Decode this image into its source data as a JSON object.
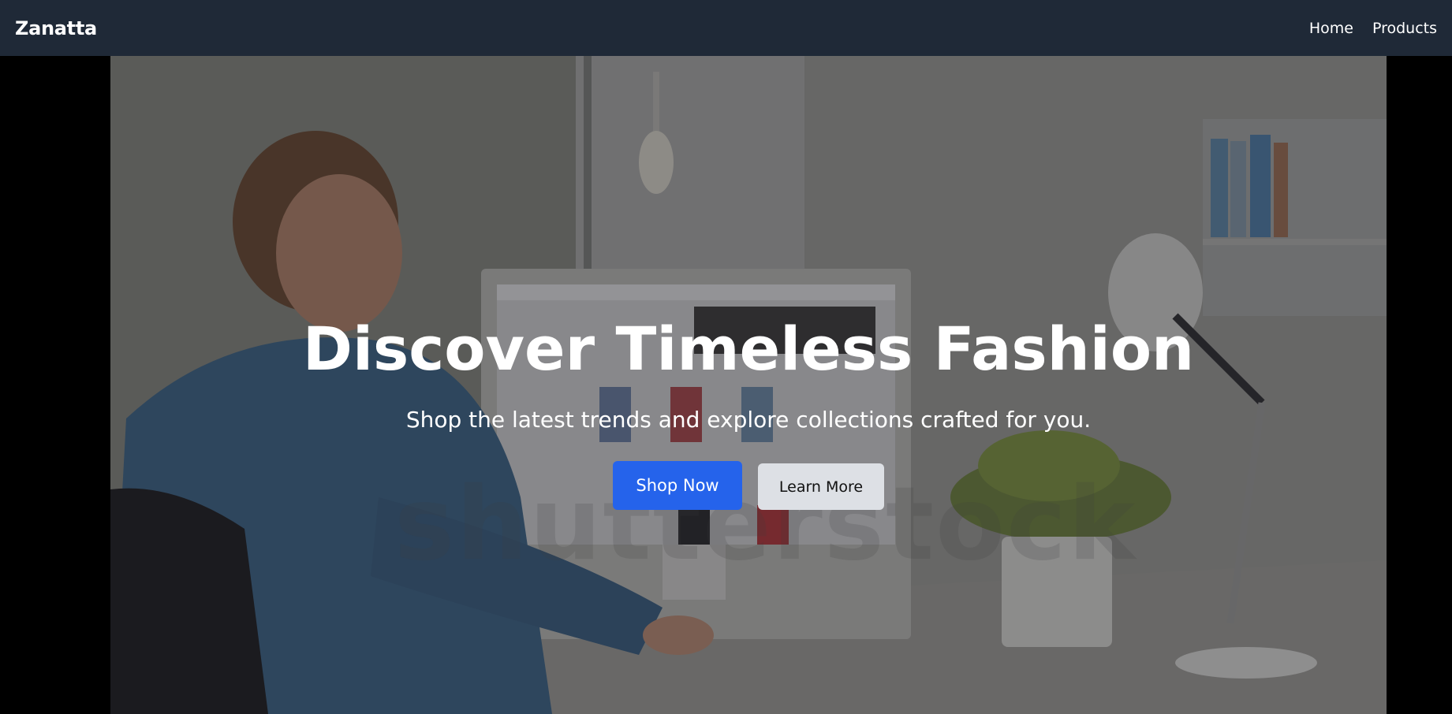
{
  "navbar": {
    "brand": "Zanatta",
    "links": [
      "Home",
      "Products"
    ]
  },
  "hero": {
    "title": "Discover Timeless Fashion",
    "subtitle": "Shop the latest trends and explore collections crafted for you.",
    "primary_button": "Shop Now",
    "secondary_button": "Learn More",
    "watermark": "shutterstock",
    "image_alt": "Man with glasses working at a computer displaying a fashion store, bright office with plant and desk lamp"
  },
  "colors": {
    "navbar_bg": "#1f2937",
    "primary": "#2563eb",
    "secondary_bg": "#dde0e5",
    "page_bg": "#000000"
  }
}
